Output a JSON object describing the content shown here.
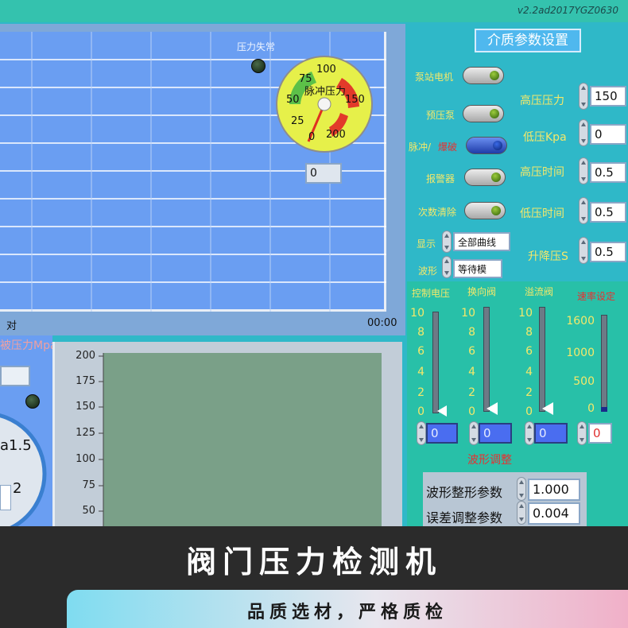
{
  "version": "v2.2ad2017YGZ0630",
  "chart": {
    "indicator_label": "压力失常",
    "gauge": {
      "title": "脉冲压力",
      "ticks": [
        "0",
        "25",
        "50",
        "75",
        "100",
        "150",
        "200"
      ],
      "readout": "0"
    },
    "x_left": "对",
    "x_right": "00:00"
  },
  "params": {
    "title": "介质参数设置",
    "switches": [
      {
        "label": "泵站电机"
      },
      {
        "label": "预压泵"
      },
      {
        "label_a": "脉冲/",
        "label_b": "爆破"
      },
      {
        "label": "报警器"
      },
      {
        "label": "次数清除"
      }
    ],
    "fields": [
      {
        "label": "高压压力",
        "value": "150"
      },
      {
        "label": "低压Kpa",
        "value": "0"
      },
      {
        "label": "高压时间",
        "value": "0.5"
      },
      {
        "label": "低压时间",
        "value": "0.5"
      },
      {
        "label": "升降压S",
        "value": "0.5"
      }
    ],
    "display_label": "显示",
    "display_value": "全部曲线",
    "wave_label": "波形",
    "wave_value": "等待模"
  },
  "sliders": {
    "groups": [
      {
        "label": "控制电压",
        "ticks": [
          "10",
          "8",
          "6",
          "4",
          "2",
          "0"
        ],
        "value": "0"
      },
      {
        "label": "换向阀",
        "ticks": [
          "10",
          "8",
          "6",
          "4",
          "2",
          "0"
        ],
        "value": "0"
      },
      {
        "label": "溢流阀",
        "ticks": [
          "10",
          "8",
          "6",
          "4",
          "2",
          "0"
        ],
        "value": "0"
      },
      {
        "label": "速率设定",
        "ticks": [
          "1600",
          "1000",
          "500",
          "0"
        ],
        "value": "0"
      }
    ]
  },
  "wave_adjust": {
    "title": "波形调整",
    "rows": [
      {
        "label": "波形整形参数",
        "value": "1.000"
      },
      {
        "label": "误差调整参数",
        "value": "0.004"
      }
    ]
  },
  "left_gauge": {
    "title": "被压力Mpa",
    "tick_a": "a1.5",
    "tick_b": "2"
  },
  "bottom_chart": {
    "y_ticks": [
      "200",
      "175",
      "150",
      "125",
      "100",
      "75",
      "50"
    ]
  },
  "banner": {
    "title": "阀门压力检测机",
    "subtitle": "品质选材，严格质检"
  },
  "colors": {
    "panel": "#2fb8c8",
    "chart_bg": "#6a9ef2",
    "plot_bg": "#7aa088",
    "label": "#f4e86a",
    "banner": "#2b2b2b"
  }
}
